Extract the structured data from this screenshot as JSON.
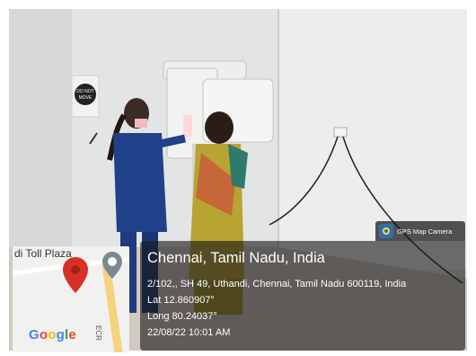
{
  "map": {
    "place_label": "di Toll Plaza",
    "road_label": "ECR",
    "google_letters": [
      "G",
      "o",
      "o",
      "g",
      "l",
      "e"
    ],
    "google_colors": [
      "#4285F4",
      "#EA4335",
      "#FBBC05",
      "#4285F4",
      "#34A853",
      "#EA4335"
    ],
    "pin_color": "#d93025",
    "secondary_pin_color": "#7b8795"
  },
  "badge": {
    "label": "GPS Map Camera"
  },
  "info": {
    "title": "Chennai, Tamil Nadu, India",
    "address": "2/102,, SH 49, Uthandi, Chennai, Tamil Nadu 600119, India",
    "lat": "Lat 12.860907°",
    "long": "Long 80.24037°",
    "datetime": "22/08/22 10:01 AM"
  },
  "scene": {
    "wall_sign": "DO NOT MOVE"
  }
}
